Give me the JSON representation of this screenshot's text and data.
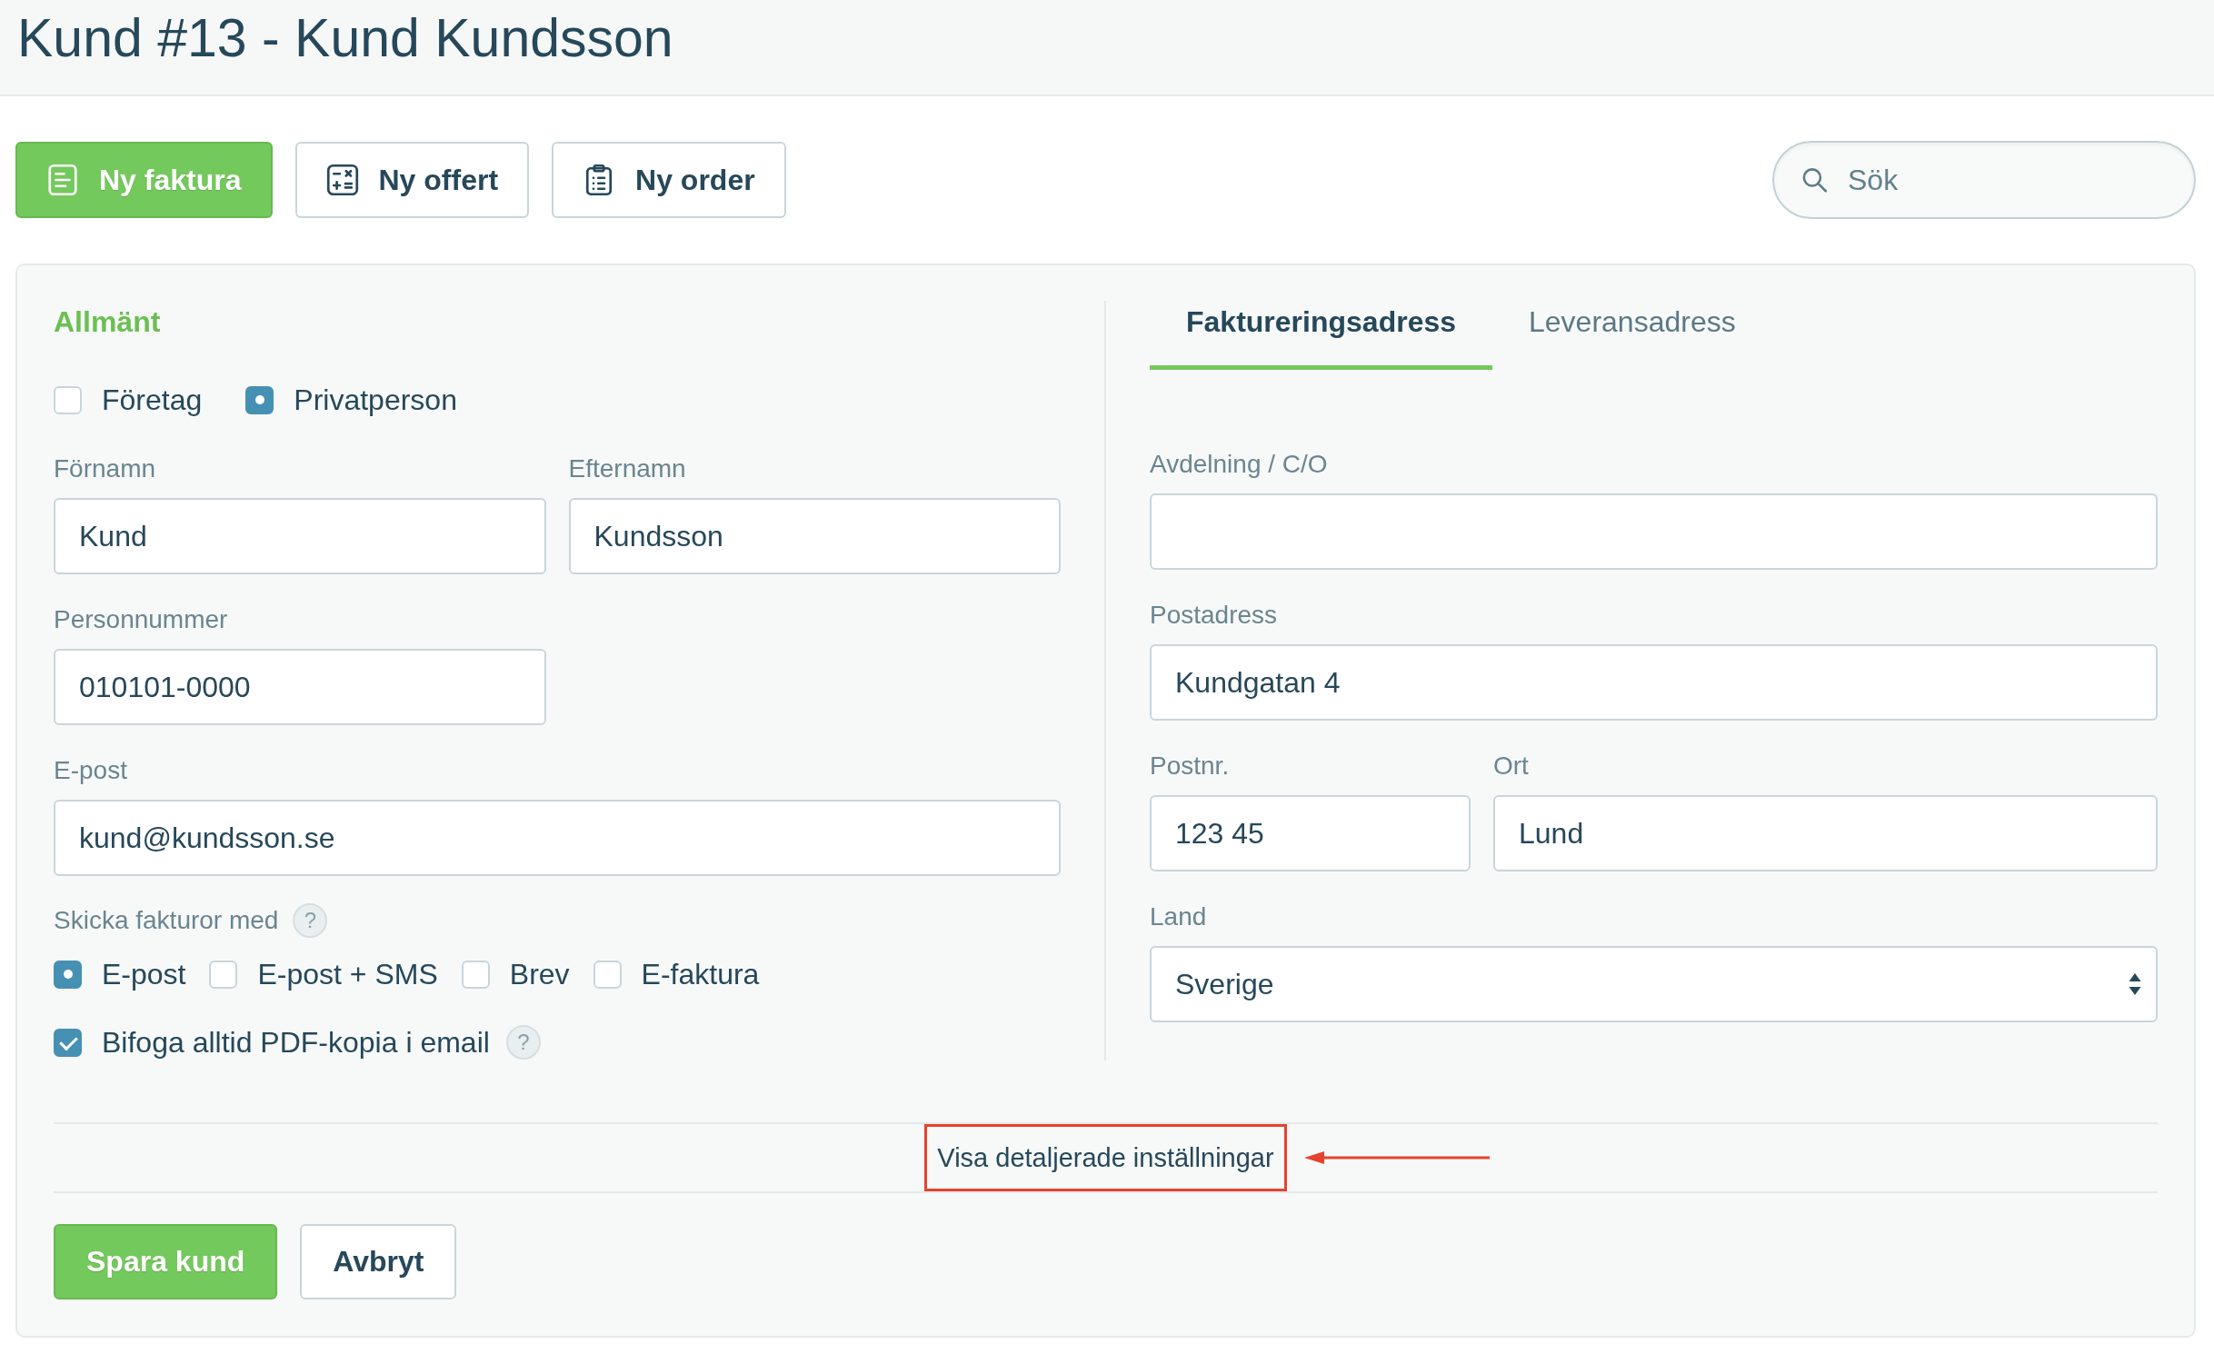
{
  "page": {
    "title": "Kund #13 - Kund Kundsson"
  },
  "toolbar": {
    "buttons": [
      {
        "label": "Ny faktura",
        "primary": true
      },
      {
        "label": "Ny offert",
        "primary": false
      },
      {
        "label": "Ny order",
        "primary": false
      }
    ],
    "search": {
      "placeholder": "Sök"
    }
  },
  "general": {
    "heading": "Allmänt",
    "customer_type": [
      {
        "label": "Företag",
        "selected": false
      },
      {
        "label": "Privatperson",
        "selected": true
      }
    ],
    "first_name": {
      "label": "Förnamn",
      "value": "Kund"
    },
    "last_name": {
      "label": "Efternamn",
      "value": "Kundsson"
    },
    "personal_number": {
      "label": "Personnummer",
      "value": "010101-0000"
    },
    "email": {
      "label": "E-post",
      "value": "kund@kundsson.se"
    },
    "invoice_delivery": {
      "label": "Skicka fakturor med",
      "help": "?",
      "options": [
        {
          "label": "E-post",
          "selected": true
        },
        {
          "label": "E-post + SMS",
          "selected": false
        },
        {
          "label": "Brev",
          "selected": false
        },
        {
          "label": "E-faktura",
          "selected": false
        }
      ]
    },
    "attach_pdf": {
      "label": "Bifoga alltid PDF-kopia i email",
      "checked": true,
      "help": "?"
    }
  },
  "address": {
    "tabs": [
      {
        "label": "Faktureringsadress",
        "selected": true
      },
      {
        "label": "Leveransadress",
        "selected": false
      }
    ],
    "department": {
      "label": "Avdelning / C/O"
    },
    "street": {
      "label": "Postadress",
      "value": "Kundgatan 4"
    },
    "postal_code": {
      "label": "Postnr.",
      "value": "123 45"
    },
    "city": {
      "label": "Ort",
      "value": "Lund"
    },
    "country": {
      "label": "Land",
      "value": "Sverige"
    }
  },
  "details_link": {
    "label": "Visa detaljerade inställningar",
    "highlighted": true
  },
  "form_buttons": [
    {
      "label": "Spara kund",
      "primary": true
    },
    {
      "label": "Avbryt",
      "primary": false
    }
  ]
}
